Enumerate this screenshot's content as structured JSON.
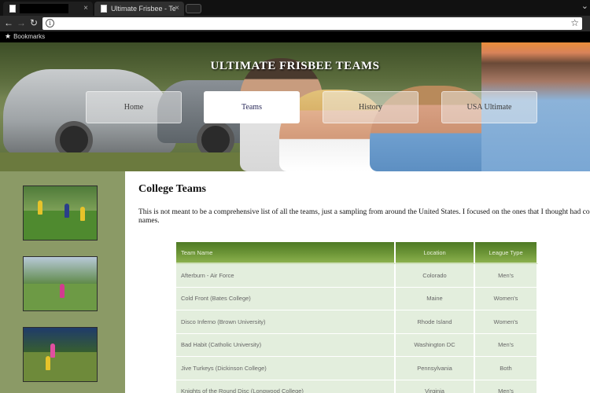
{
  "browser": {
    "tabs": [
      {
        "title": ""
      },
      {
        "title": "Ultimate Frisbee - Teams"
      }
    ],
    "close_glyph": "×",
    "window_control": "⌄",
    "bookmarks_label": "Bookmarks",
    "icons": [
      "document-icon",
      "back-arrow-icon",
      "forward-arrow-icon",
      "reload-icon",
      "info-icon",
      "star-icon"
    ]
  },
  "site": {
    "title": "ULTIMATE FRISBEE TEAMS",
    "nav": [
      {
        "label": "Home",
        "active": false
      },
      {
        "label": "Teams",
        "active": true
      },
      {
        "label": "History",
        "active": false
      },
      {
        "label": "USA Ultimate",
        "active": false
      }
    ]
  },
  "content": {
    "heading": "College Teams",
    "intro": "This is not meant to be a comprehensive list of all the teams, just a sampling from around the United States. I focused on the ones that I thought had cool names.",
    "table": {
      "headers": [
        "Team Name",
        "Location",
        "League Type"
      ],
      "rows": [
        [
          "Afterburn - Air Force",
          "Colorado",
          "Men's"
        ],
        [
          "Cold Front (Bates College)",
          "Maine",
          "Women's"
        ],
        [
          "Disco Inferno (Brown University)",
          "Rhode Island",
          "Women's"
        ],
        [
          "Bad Habit (Catholic University)",
          "Washington DC",
          "Men's"
        ],
        [
          "Jive Turkeys (Dickinson College)",
          "Pennsylvania",
          "Both"
        ],
        [
          "Knights of the Round Disc (Longwood College)",
          "Virginia",
          "Men's"
        ]
      ]
    }
  },
  "colors": {
    "sidebar": "#8b9a66",
    "table_header": "#6d9637",
    "table_row": "#e3eedd",
    "active_nav_text": "#2a2a5a"
  }
}
